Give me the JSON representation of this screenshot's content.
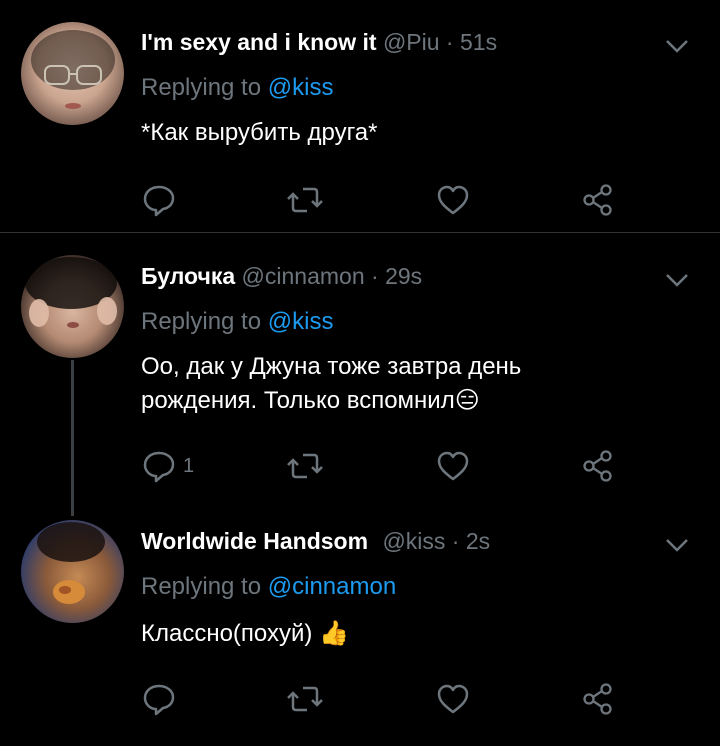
{
  "tweets": [
    {
      "name": "I'm sexy and i know it",
      "handle": "@Piu",
      "time": "51s",
      "replying_label": "Replying to",
      "replying_to": "@kiss",
      "text_lines": [
        "*Как вырубить друга*"
      ],
      "reply_count": ""
    },
    {
      "name": "Булочка",
      "handle": "@cinnamon",
      "time": "29s",
      "replying_label": "Replying to",
      "replying_to": "@kiss",
      "text_lines": [
        "Оо, дак у Джуна тоже завтра день",
        "рождения. Только вспомнил😑"
      ],
      "reply_count": "1"
    },
    {
      "name": "Worldwide Handsom",
      "handle": "@kiss",
      "time": "2s",
      "replying_label": "Replying to",
      "replying_to": "@cinnamon",
      "text_lines": [
        "Классно(похуй) 👍"
      ],
      "reply_count": ""
    }
  ],
  "colors": {
    "background": "#000000",
    "secondary_text": "#6e767d",
    "mention": "#1d9bf0",
    "divider": "#2f3336"
  },
  "icons": [
    "chevron-down-icon",
    "reply-icon",
    "retweet-icon",
    "like-icon",
    "share-icon"
  ]
}
